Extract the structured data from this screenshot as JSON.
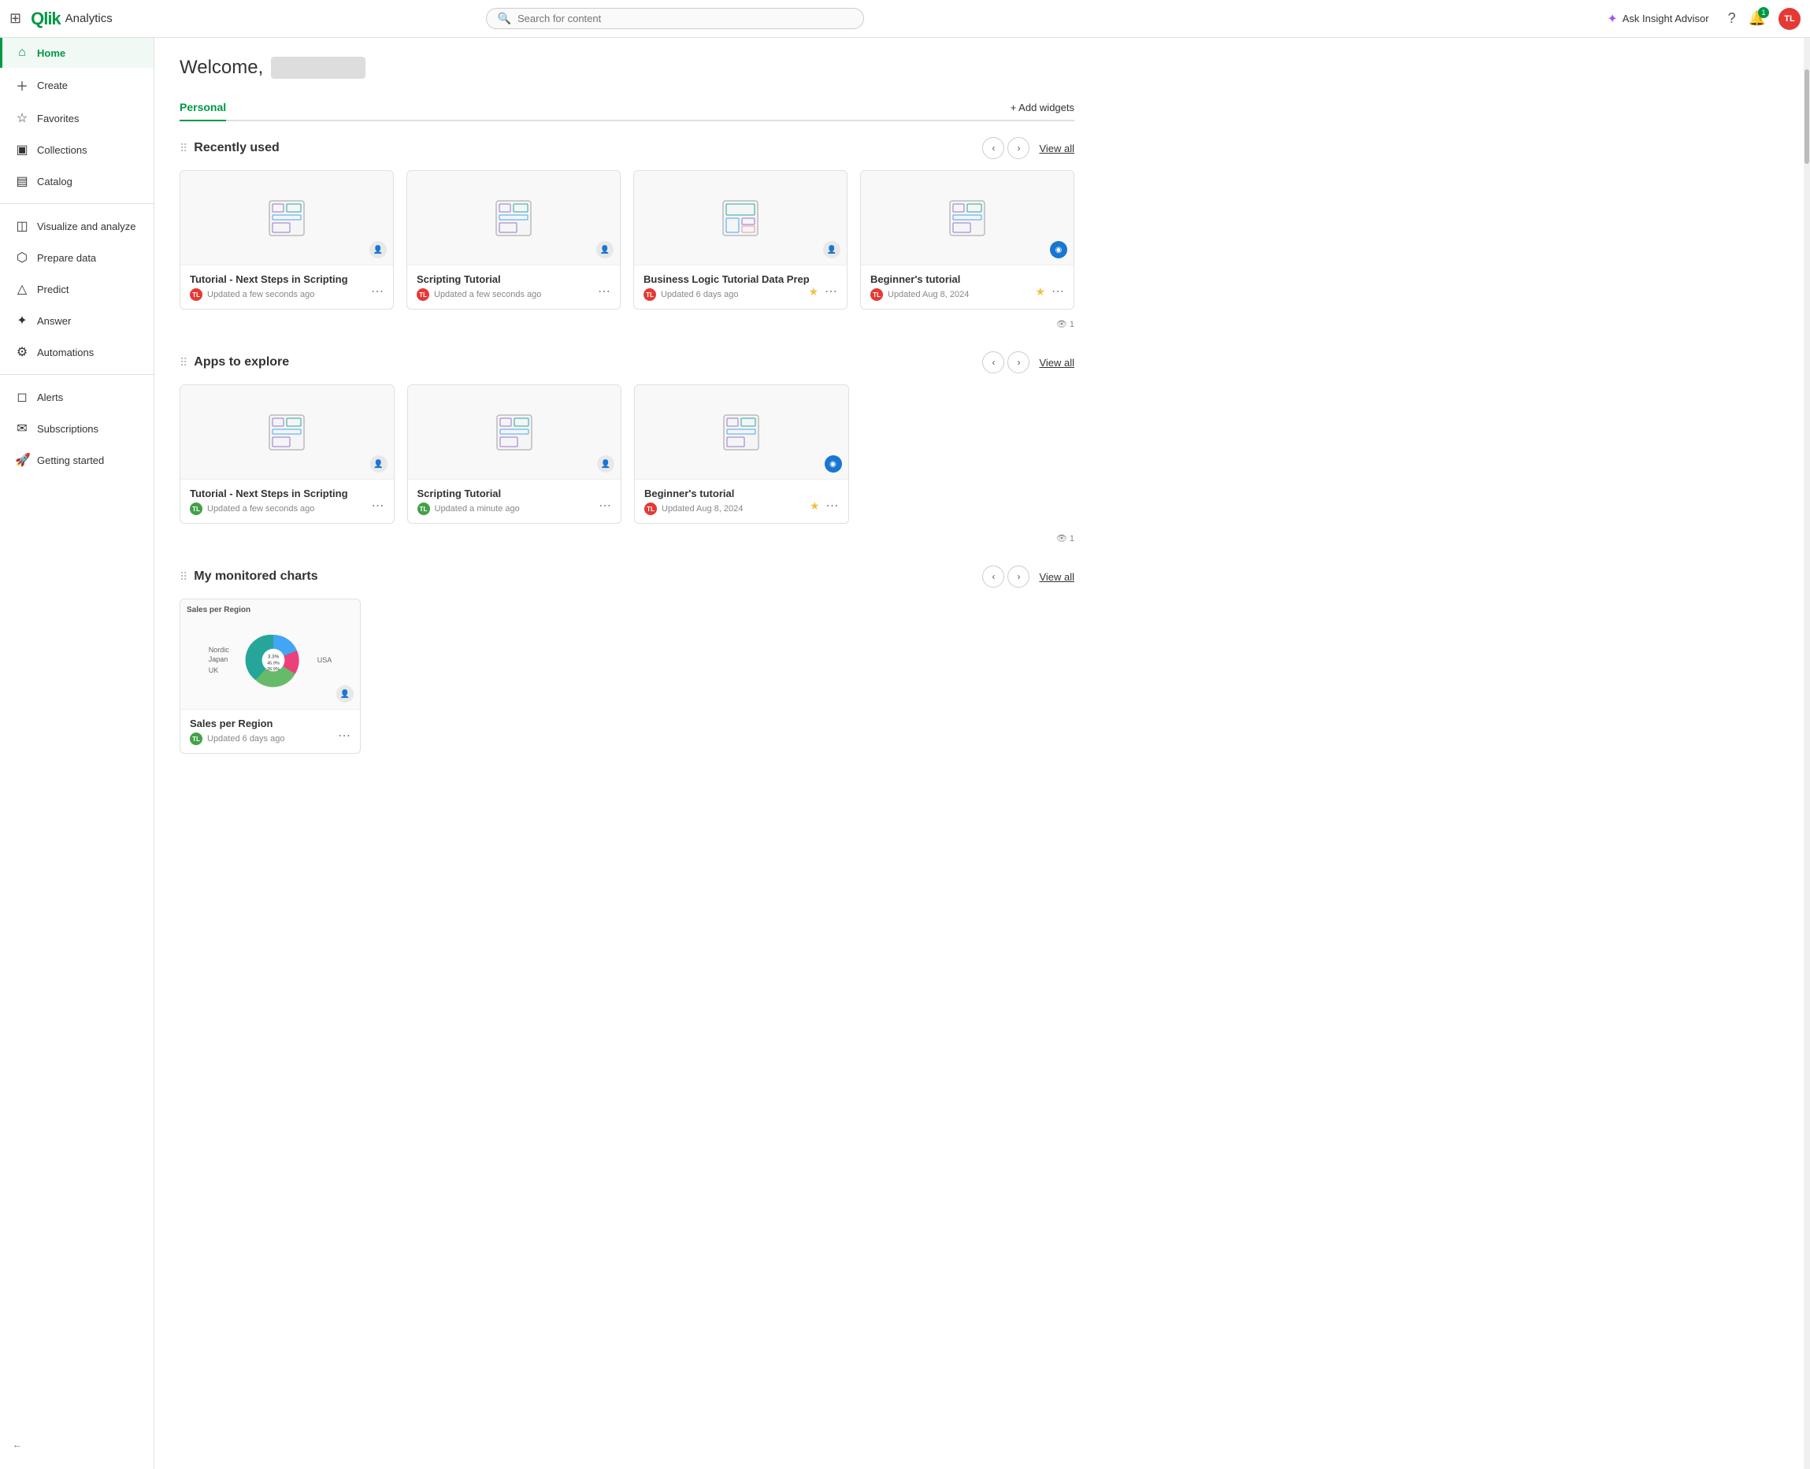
{
  "topnav": {
    "logo": "Qlik",
    "app_name": "Analytics",
    "search_placeholder": "Search for content",
    "insight_advisor_label": "Ask Insight Advisor",
    "bell_count": "1",
    "avatar_initials": "TL"
  },
  "sidebar": {
    "items": [
      {
        "id": "home",
        "label": "Home",
        "icon": "⌂",
        "active": true
      },
      {
        "id": "create",
        "label": "Create",
        "icon": "＋"
      },
      {
        "id": "favorites",
        "label": "Favorites",
        "icon": "☆"
      },
      {
        "id": "collections",
        "label": "Collections",
        "icon": "▣"
      },
      {
        "id": "catalog",
        "label": "Catalog",
        "icon": "▤"
      },
      {
        "id": "sep1",
        "type": "divider"
      },
      {
        "id": "visualize",
        "label": "Visualize and analyze",
        "icon": "◫"
      },
      {
        "id": "prepare",
        "label": "Prepare data",
        "icon": "⬡"
      },
      {
        "id": "predict",
        "label": "Predict",
        "icon": "△"
      },
      {
        "id": "answer",
        "label": "Answer",
        "icon": "✦"
      },
      {
        "id": "automations",
        "label": "Automations",
        "icon": "⚙"
      },
      {
        "id": "sep2",
        "type": "divider"
      },
      {
        "id": "alerts",
        "label": "Alerts",
        "icon": "◻"
      },
      {
        "id": "subscriptions",
        "label": "Subscriptions",
        "icon": "✉"
      },
      {
        "id": "getting_started",
        "label": "Getting started",
        "icon": "🚀"
      }
    ],
    "collapse_label": "←"
  },
  "welcome": {
    "title": "Welcome,",
    "name_placeholder": "█████████"
  },
  "tabs": [
    {
      "id": "personal",
      "label": "Personal",
      "active": true
    }
  ],
  "add_widgets_label": "+ Add widgets",
  "sections": [
    {
      "id": "recently_used",
      "title": "Recently used",
      "view_all": "View all",
      "cards": [
        {
          "id": "c1",
          "title": "Tutorial - Next Steps in Scripting",
          "updated": "Updated a few seconds ago",
          "avatar_color": "#e53935",
          "avatar_initials": "TL",
          "starred": false,
          "badge_type": "user"
        },
        {
          "id": "c2",
          "title": "Scripting Tutorial",
          "updated": "Updated a few seconds ago",
          "avatar_color": "#e53935",
          "avatar_initials": "TL",
          "starred": false,
          "badge_type": "user"
        },
        {
          "id": "c3",
          "title": "Business Logic Tutorial Data Prep",
          "updated": "Updated 6 days ago",
          "avatar_color": "#e53935",
          "avatar_initials": "TL",
          "starred": true,
          "badge_type": "user"
        },
        {
          "id": "c4",
          "title": "Beginner's tutorial",
          "updated": "Updated Aug 8, 2024",
          "avatar_color": "#e53935",
          "avatar_initials": "TL",
          "starred": true,
          "badge_type": "blue"
        }
      ],
      "views_count": "1"
    },
    {
      "id": "apps_to_explore",
      "title": "Apps to explore",
      "view_all": "View all",
      "cards": [
        {
          "id": "e1",
          "title": "Tutorial - Next Steps in Scripting",
          "updated": "Updated a few seconds ago",
          "avatar_color": "#43a047",
          "avatar_initials": "TL",
          "starred": false,
          "badge_type": "user"
        },
        {
          "id": "e2",
          "title": "Scripting Tutorial",
          "updated": "Updated a minute ago",
          "avatar_color": "#43a047",
          "avatar_initials": "TL",
          "starred": false,
          "badge_type": "user"
        },
        {
          "id": "e3",
          "title": "Beginner's tutorial",
          "updated": "Updated Aug 8, 2024",
          "avatar_color": "#e53935",
          "avatar_initials": "TL",
          "starred": true,
          "badge_type": "blue"
        }
      ],
      "views_count": "1"
    },
    {
      "id": "my_monitored_charts",
      "title": "My monitored charts",
      "view_all": "View all",
      "cards": [
        {
          "id": "m1",
          "title": "Sales per Region",
          "updated": "Updated 6 days ago",
          "avatar_color": "#43a047",
          "avatar_initials": "TL",
          "chart_type": "pie",
          "badge_type": "user",
          "chart_title": "Sales per Region",
          "chart_data": [
            {
              "label": "USA",
              "value": 45.9,
              "color": "#26a69a"
            },
            {
              "label": "Nordic",
              "value": 14.9,
              "color": "#42a5f5"
            },
            {
              "label": "Japan",
              "value": 12.3,
              "color": "#ec407a"
            },
            {
              "label": "UK",
              "value": 26.9,
              "color": "#66bb6a"
            }
          ]
        }
      ]
    }
  ]
}
